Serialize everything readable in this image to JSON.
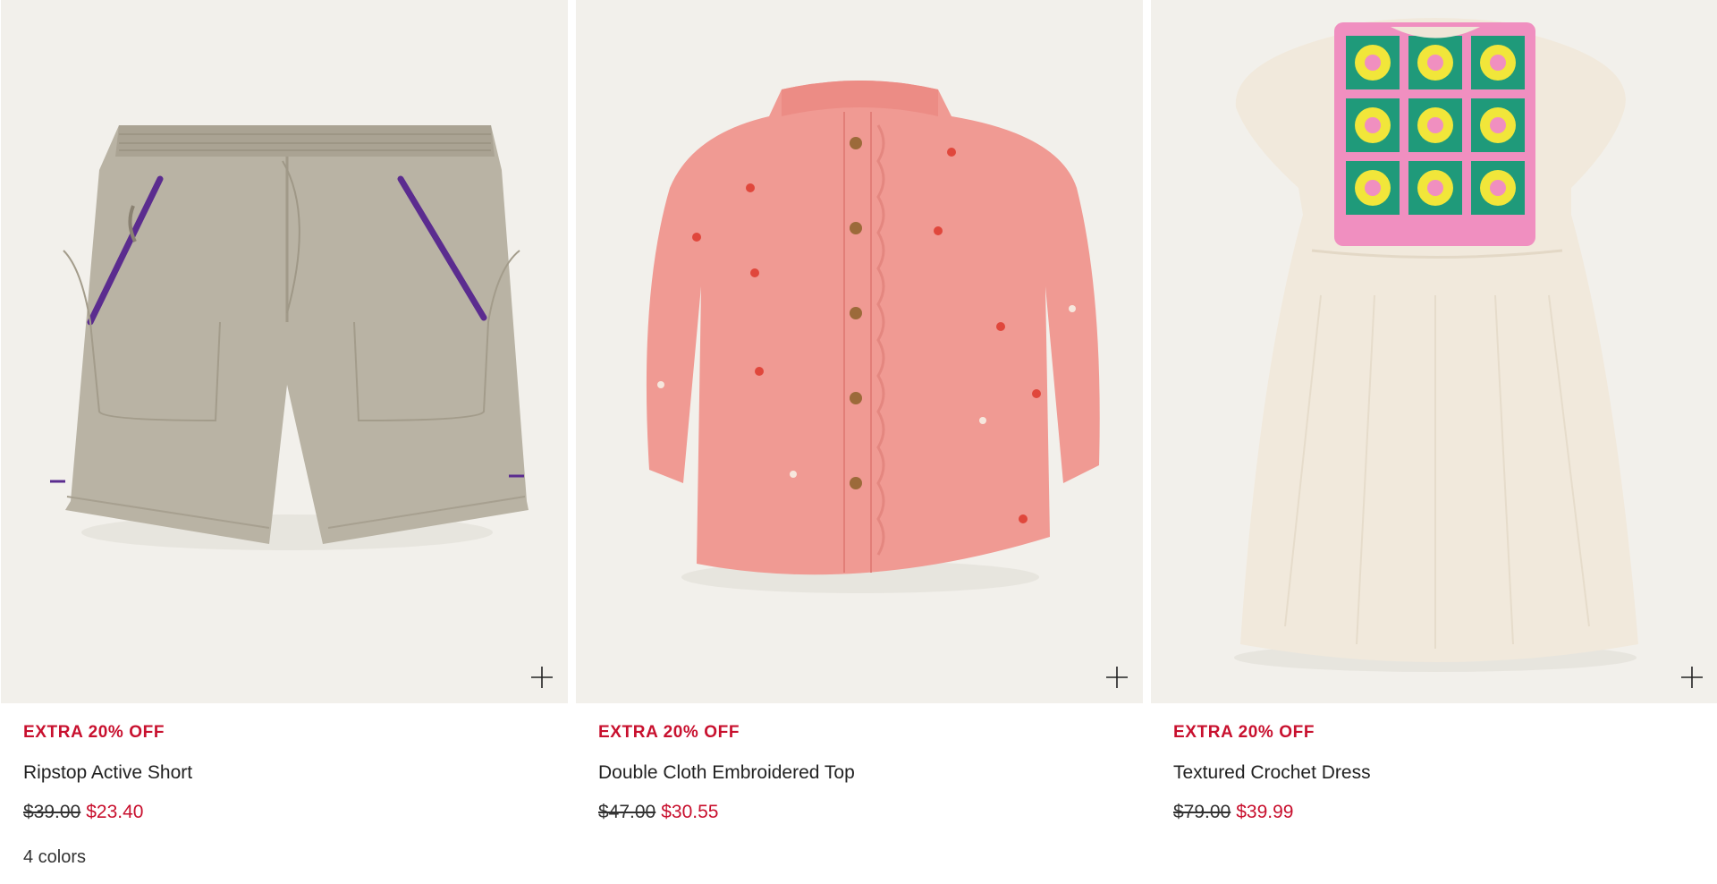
{
  "products": [
    {
      "promo": "EXTRA 20% OFF",
      "name": "Ripstop Active Short",
      "price_was": "$39.00",
      "price_now": "$23.40",
      "colors": "4 colors",
      "image_icon": "shorts-image",
      "quick_add_icon": "plus-icon"
    },
    {
      "promo": "EXTRA 20% OFF",
      "name": "Double Cloth Embroidered Top",
      "price_was": "$47.00",
      "price_now": "$30.55",
      "image_icon": "blouse-image",
      "quick_add_icon": "plus-icon"
    },
    {
      "promo": "EXTRA 20% OFF",
      "name": "Textured Crochet Dress",
      "price_was": "$79.00",
      "price_now": "$39.99",
      "image_icon": "dress-image",
      "quick_add_icon": "plus-icon"
    }
  ],
  "colors": {
    "promo_red": "#c8102e",
    "image_bg": "#f2f0eb",
    "text": "#222222"
  }
}
